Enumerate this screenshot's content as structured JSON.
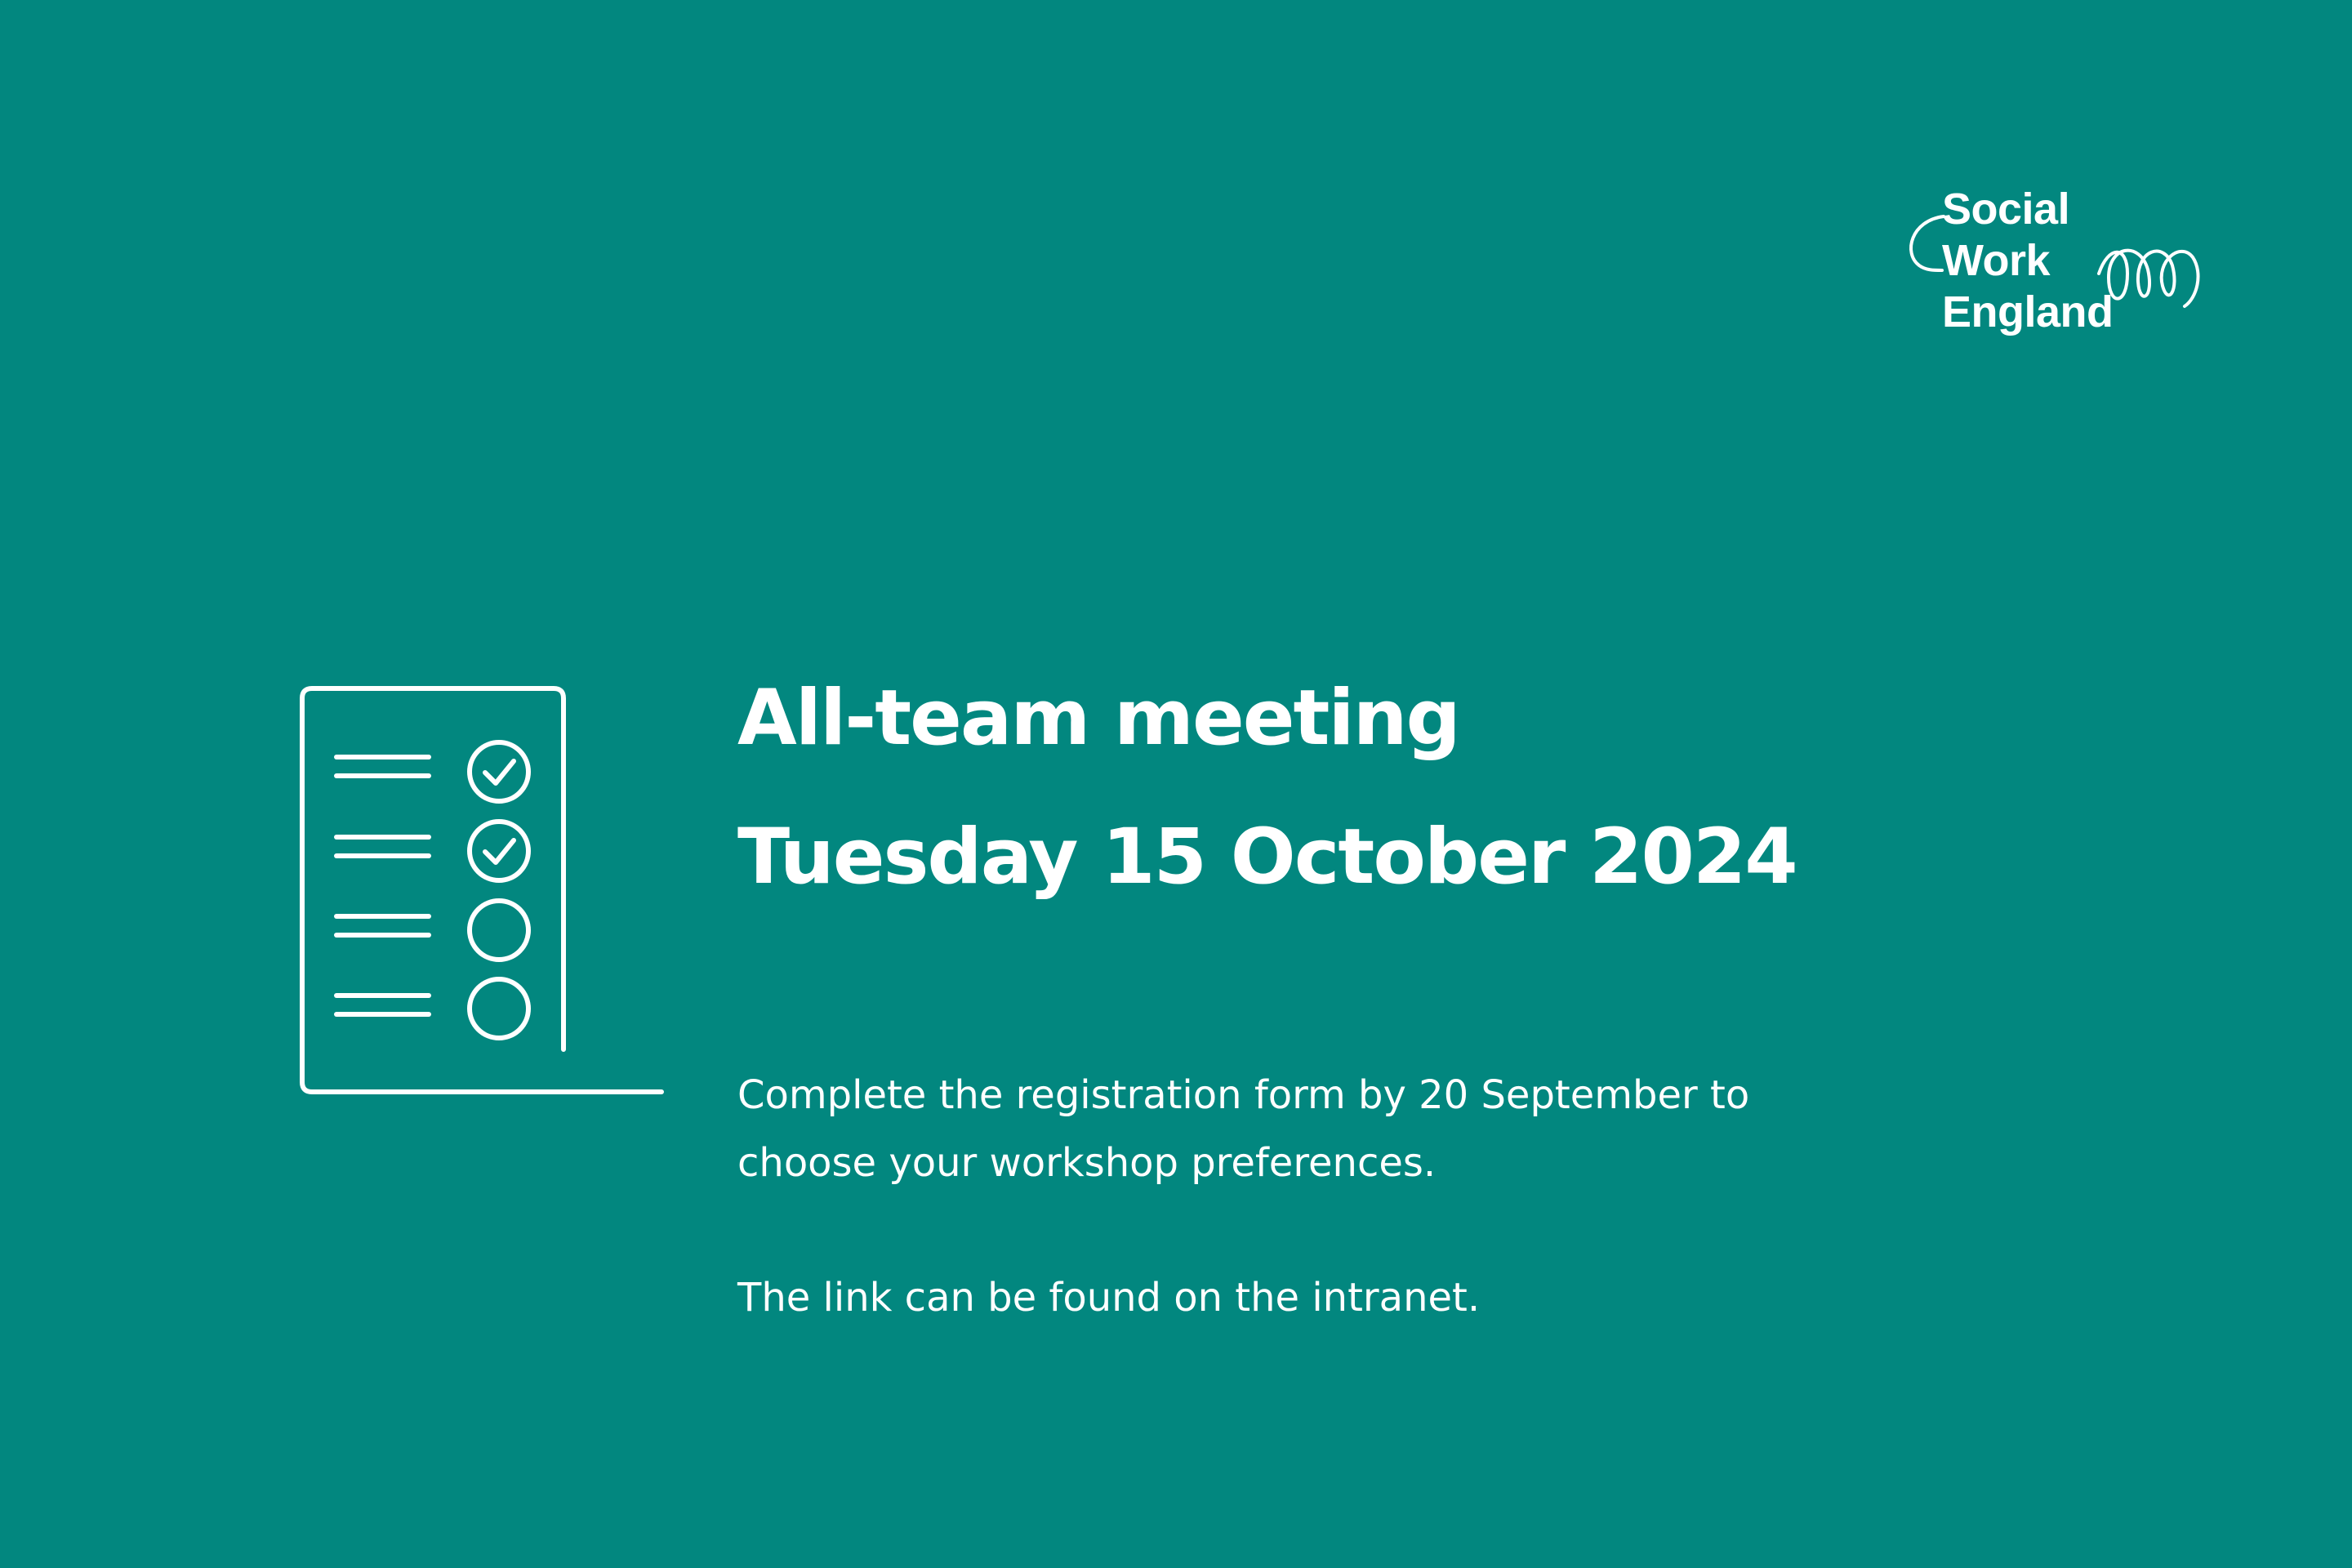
{
  "logo": {
    "lines": [
      "Social",
      "Work",
      "England"
    ],
    "icon": "swirl-loop-icon"
  },
  "icons": {
    "checklist": "checklist-document-icon"
  },
  "heading": {
    "title": "All-team meeting",
    "date": "Tuesday 15 October 2024"
  },
  "body": {
    "line1": "Complete the registration form by 20 September to",
    "line2": "choose your workshop preferences.",
    "line3": "The link can be found on the intranet."
  },
  "colors": {
    "background": "#02877f",
    "foreground": "#ffffff"
  }
}
